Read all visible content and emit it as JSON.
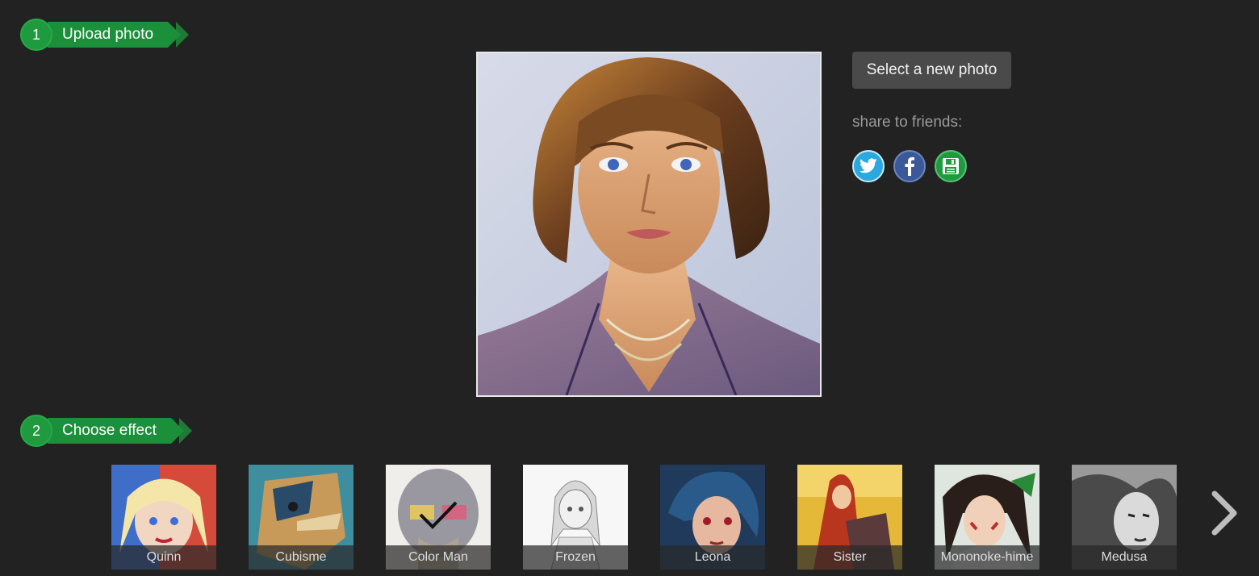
{
  "steps": [
    {
      "number": "1",
      "label": "Upload photo"
    },
    {
      "number": "2",
      "label": "Choose effect"
    }
  ],
  "actions": {
    "select_photo_label": "Select a new photo",
    "share_label": "share to friends:"
  },
  "share_icons": [
    "twitter-icon",
    "facebook-icon",
    "save-icon"
  ],
  "effects": [
    {
      "label": "Quinn",
      "selected": false
    },
    {
      "label": "Cubisme",
      "selected": false
    },
    {
      "label": "Color Man",
      "selected": true
    },
    {
      "label": "Frozen",
      "selected": false
    },
    {
      "label": "Leona",
      "selected": false
    },
    {
      "label": "Sister",
      "selected": false
    },
    {
      "label": "Mononoke-hime",
      "selected": false
    },
    {
      "label": "Medusa",
      "selected": false
    }
  ],
  "colors": {
    "background": "#222222",
    "step_green": "#1b8f3a",
    "button": "#4a4a4a"
  }
}
